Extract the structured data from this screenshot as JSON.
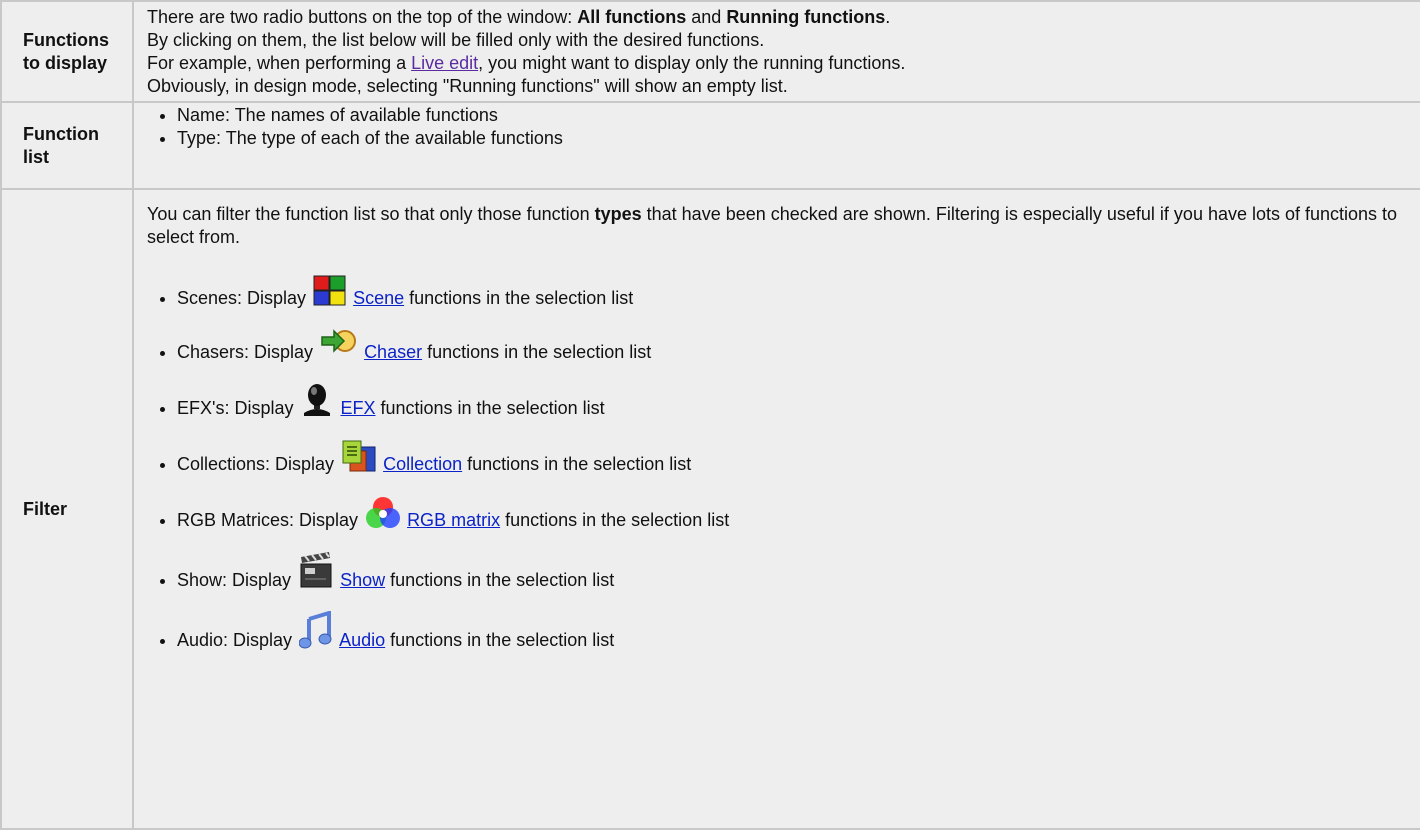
{
  "rows": [
    {
      "label": "Functions to display",
      "lines": {
        "l1_pre": "There are two radio buttons on the top of the window: ",
        "l1_b1": "All functions",
        "l1_mid": " and ",
        "l1_b2": "Running functions",
        "l1_post": ".",
        "l2": "By clicking on them, the list below will be filled only with the desired functions.",
        "l3_pre": "For example, when performing a ",
        "l3_link": "Live edit",
        "l3_post": ", you might want to display only the running functions.",
        "l4": "Obviously, in design mode, selecting \"Running functions\" will show an empty list."
      }
    },
    {
      "label": "Function list",
      "items": [
        "Name: The names of available functions",
        "Type: The type of each of the available functions"
      ]
    },
    {
      "label": "Filter",
      "intro_pre": "You can filter the function list so that only those function ",
      "intro_bold": "types",
      "intro_post": " that have been checked are shown. Filtering is especially useful if you have lots of functions to select from.",
      "items": [
        {
          "prefix": "Scenes: Display",
          "icon": "scene-icon",
          "link": "Scene",
          "suffix": " functions in the selection list"
        },
        {
          "prefix": "Chasers: Display",
          "icon": "chaser-icon",
          "link": "Chaser",
          "suffix": " functions in the selection list"
        },
        {
          "prefix": "EFX's: Display",
          "icon": "efx-icon",
          "link": "EFX",
          "suffix": " functions in the selection list"
        },
        {
          "prefix": "Collections: Display",
          "icon": "collection-icon",
          "link": "Collection",
          "suffix": " functions in the selection list"
        },
        {
          "prefix": "RGB Matrices: Display",
          "icon": "rgb-matrix-icon",
          "link": "RGB matrix",
          "suffix": " functions in the selection list"
        },
        {
          "prefix": "Show: Display",
          "icon": "show-icon",
          "link": "Show",
          "suffix": " functions in the selection list"
        },
        {
          "prefix": "Audio: Display",
          "icon": "audio-icon",
          "link": "Audio",
          "suffix": " functions in the selection list"
        }
      ]
    }
  ]
}
